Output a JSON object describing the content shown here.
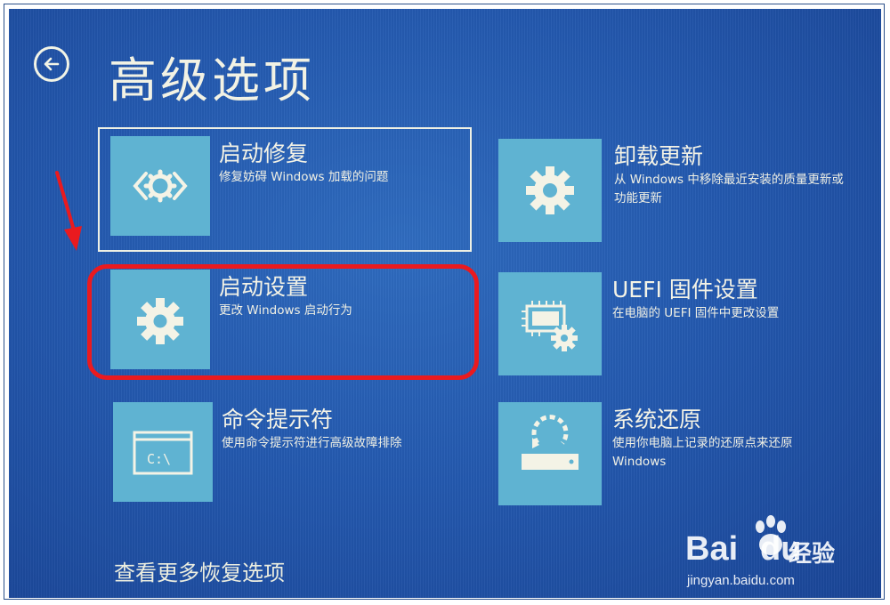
{
  "header": {
    "title": "高级选项"
  },
  "options": [
    {
      "id": "startup-repair",
      "title": "启动修复",
      "desc": "修复妨碍 Windows 加载的问题",
      "icon": "code-gear-icon"
    },
    {
      "id": "uninstall-updates",
      "title": "卸载更新",
      "desc": "从 Windows 中移除最近安装的质量更新或功能更新",
      "icon": "gear-icon"
    },
    {
      "id": "startup-settings",
      "title": "启动设置",
      "desc": "更改 Windows 启动行为",
      "icon": "gear-icon"
    },
    {
      "id": "uefi-firmware",
      "title": "UEFI 固件设置",
      "desc": "在电脑的 UEFI 固件中更改设置",
      "icon": "chip-gear-icon"
    },
    {
      "id": "command-prompt",
      "title": "命令提示符",
      "desc": "使用命令提示符进行高级故障排除",
      "icon": "terminal-icon"
    },
    {
      "id": "system-restore",
      "title": "系统还原",
      "desc": "使用你电脑上记录的还原点来还原 Windows",
      "icon": "restore-icon"
    }
  ],
  "cmd_icon_text": "C:\\",
  "footer": {
    "more_options": "查看更多恢复选项"
  },
  "watermark": {
    "brand": "Bai",
    "brand_suffix": "du",
    "cn": "经验",
    "url": "jingyan.baidu.com"
  },
  "colors": {
    "background": "#245ab0",
    "tile": "#5fb3d2",
    "text": "#f2f2e4",
    "annotation": "#ea1a1f"
  }
}
